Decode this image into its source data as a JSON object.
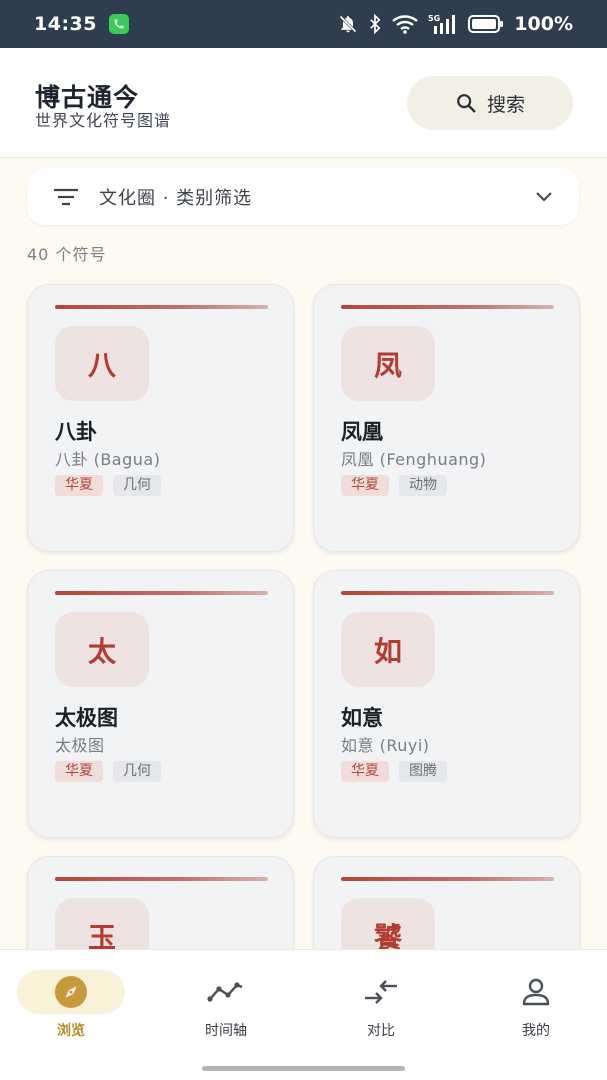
{
  "status_bar": {
    "time": "14:35",
    "battery": "100%",
    "icons": [
      "phone-app-icon",
      "mute-bell-icon",
      "bluetooth-icon",
      "wifi-icon",
      "5g-signal-icon",
      "battery-icon"
    ]
  },
  "header": {
    "title": "博古通今",
    "subtitle": "世界文化符号图谱",
    "search_label": "搜索"
  },
  "filter": {
    "label": "文化圈 · 类别筛选"
  },
  "count_text": "40 个符号",
  "cards": [
    {
      "glyph": "八",
      "name": "八卦",
      "sub": "八卦 (Bagua)",
      "culture": "华夏",
      "category": "几何"
    },
    {
      "glyph": "凤",
      "name": "凤凰",
      "sub": "凤凰 (Fenghuang)",
      "culture": "华夏",
      "category": "动物"
    },
    {
      "glyph": "太",
      "name": "太极图",
      "sub": "太极图",
      "culture": "华夏",
      "category": "几何"
    },
    {
      "glyph": "如",
      "name": "如意",
      "sub": "如意 (Ruyi)",
      "culture": "华夏",
      "category": "图腾"
    },
    {
      "glyph": "玉",
      "name": "",
      "sub": "",
      "culture": "",
      "category": ""
    },
    {
      "glyph": "饕",
      "name": "",
      "sub": "",
      "culture": "",
      "category": ""
    }
  ],
  "bottom_nav": [
    {
      "label": "浏览",
      "icon": "compass-icon",
      "active": true
    },
    {
      "label": "时间轴",
      "icon": "timeline-icon",
      "active": false
    },
    {
      "label": "对比",
      "icon": "compare-arrows-icon",
      "active": false
    },
    {
      "label": "我的",
      "icon": "person-icon",
      "active": false
    }
  ],
  "colors": {
    "accent_red": "#b23c32",
    "nav_active": "#b88a2a",
    "status_bar": "#2e3e4f"
  }
}
